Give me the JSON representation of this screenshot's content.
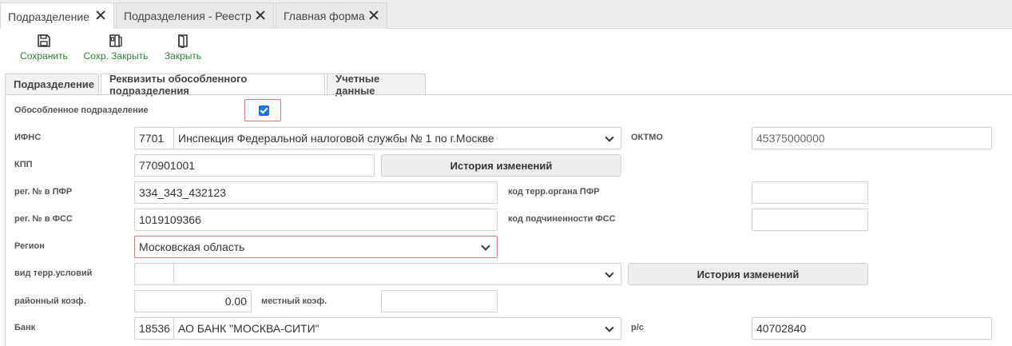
{
  "top_tabs": [
    {
      "label": "Подразделение",
      "active": true
    },
    {
      "label": "Подразделения - Реестр",
      "active": false
    },
    {
      "label": "Главная форма",
      "active": false
    }
  ],
  "toolbar": {
    "save_label": "Сохранить",
    "save_close_label": "Сохр. Закрыть",
    "close_label": "Закрыть",
    "icon_color": "#2e7d32"
  },
  "form_tabs": [
    {
      "label": "Подразделение",
      "active": false
    },
    {
      "label": "Реквизиты обособленного подразделения",
      "active": true
    },
    {
      "label": "Учетные данные",
      "active": false
    }
  ],
  "form": {
    "separate_division": {
      "label": "Обособленное подразделение",
      "checked": true
    },
    "ifns": {
      "label": "ИФНС",
      "code": "7701",
      "name": "Инспекция Федеральной налоговой службы № 1 по г.Москве"
    },
    "oktmo": {
      "label": "ОКТМО",
      "value": "45375000000"
    },
    "kpp": {
      "label": "КПП",
      "value": "770901001",
      "history_button": "История изменений"
    },
    "pfr_reg": {
      "label": "рег. № в ПФР",
      "value": "334_343_432123"
    },
    "pfr_terr_code": {
      "label": "код терр.органа ПФР",
      "value": ""
    },
    "fss_reg": {
      "label": "рег. № в ФСС",
      "value": "1019109366"
    },
    "fss_sub_code": {
      "label": "код подчиненности ФСС",
      "value": ""
    },
    "region": {
      "label": "Регион",
      "value": "Московская область"
    },
    "terr_conditions": {
      "label": "вид терр.условий",
      "code": "",
      "value": "",
      "history_button": "История изменений"
    },
    "district_coef": {
      "label": "районный коэф.",
      "value": "0.00"
    },
    "local_coef": {
      "label": "местный коэф.",
      "value": ""
    },
    "bank": {
      "label": "Банк",
      "code": "18536",
      "name": "АО БАНК \"МОСКВА-СИТИ\""
    },
    "account": {
      "label": "р/с",
      "value": "40702840"
    }
  },
  "colors": {
    "accent": "#1e73d8",
    "highlight_border": "#d9777c"
  }
}
